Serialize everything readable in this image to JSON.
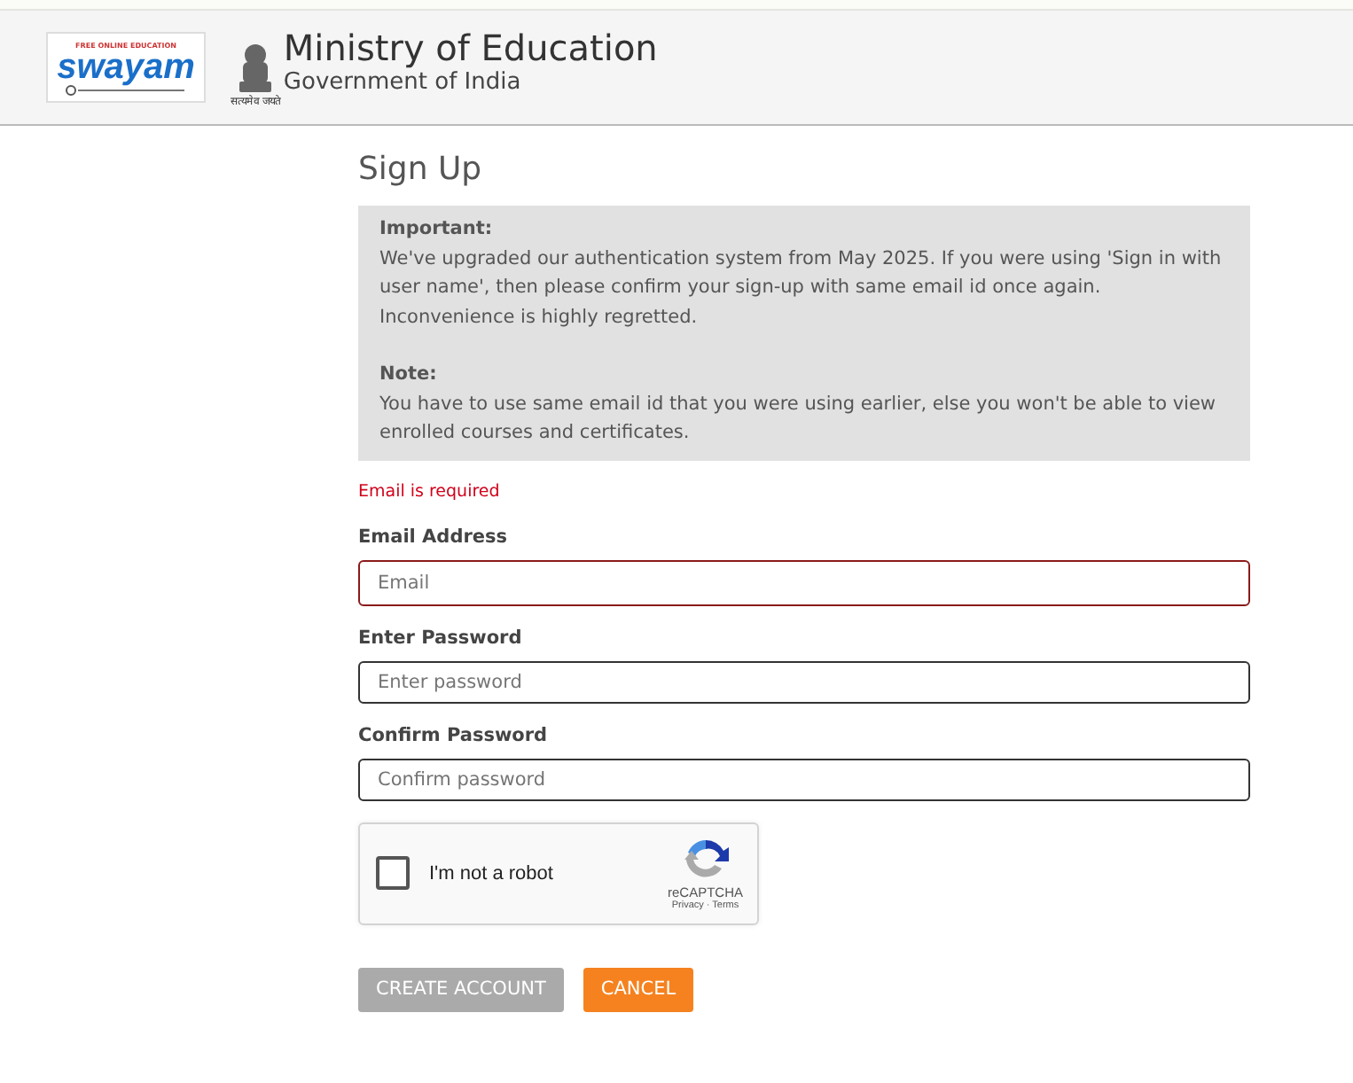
{
  "header": {
    "logo": {
      "tagline": "FREE ONLINE EDUCATION",
      "name": "swayam"
    },
    "emblem_motto": "सत्यमेव जयते",
    "title": "Ministry of Education",
    "subtitle": "Government of India"
  },
  "page_title": "Sign Up",
  "notice": [
    {
      "heading": "Important:",
      "text": "We've upgraded our authentication system from May 2025. If you were using 'Sign in with user name', then please confirm your sign-up with same email id once again. Inconvenience is highly regretted."
    },
    {
      "heading": "Note:",
      "text": "You have to use same email id that you were using earlier, else you won't be able to view enrolled courses and certificates."
    }
  ],
  "error": "Email is required",
  "fields": [
    {
      "label": "Email Address",
      "placeholder": "Email",
      "invalid": true
    },
    {
      "label": "Enter Password",
      "placeholder": "Enter password",
      "invalid": false
    },
    {
      "label": "Confirm Password",
      "placeholder": "Confirm password",
      "invalid": false
    }
  ],
  "captcha": {
    "label": "I'm not a robot",
    "checked": false,
    "brand": "reCAPTCHA",
    "links": "Privacy · Terms"
  },
  "buttons": [
    {
      "label": "CREATE ACCOUNT",
      "kind": "primary",
      "disabled": true
    },
    {
      "label": "CANCEL",
      "kind": "cancel",
      "disabled": false
    }
  ]
}
